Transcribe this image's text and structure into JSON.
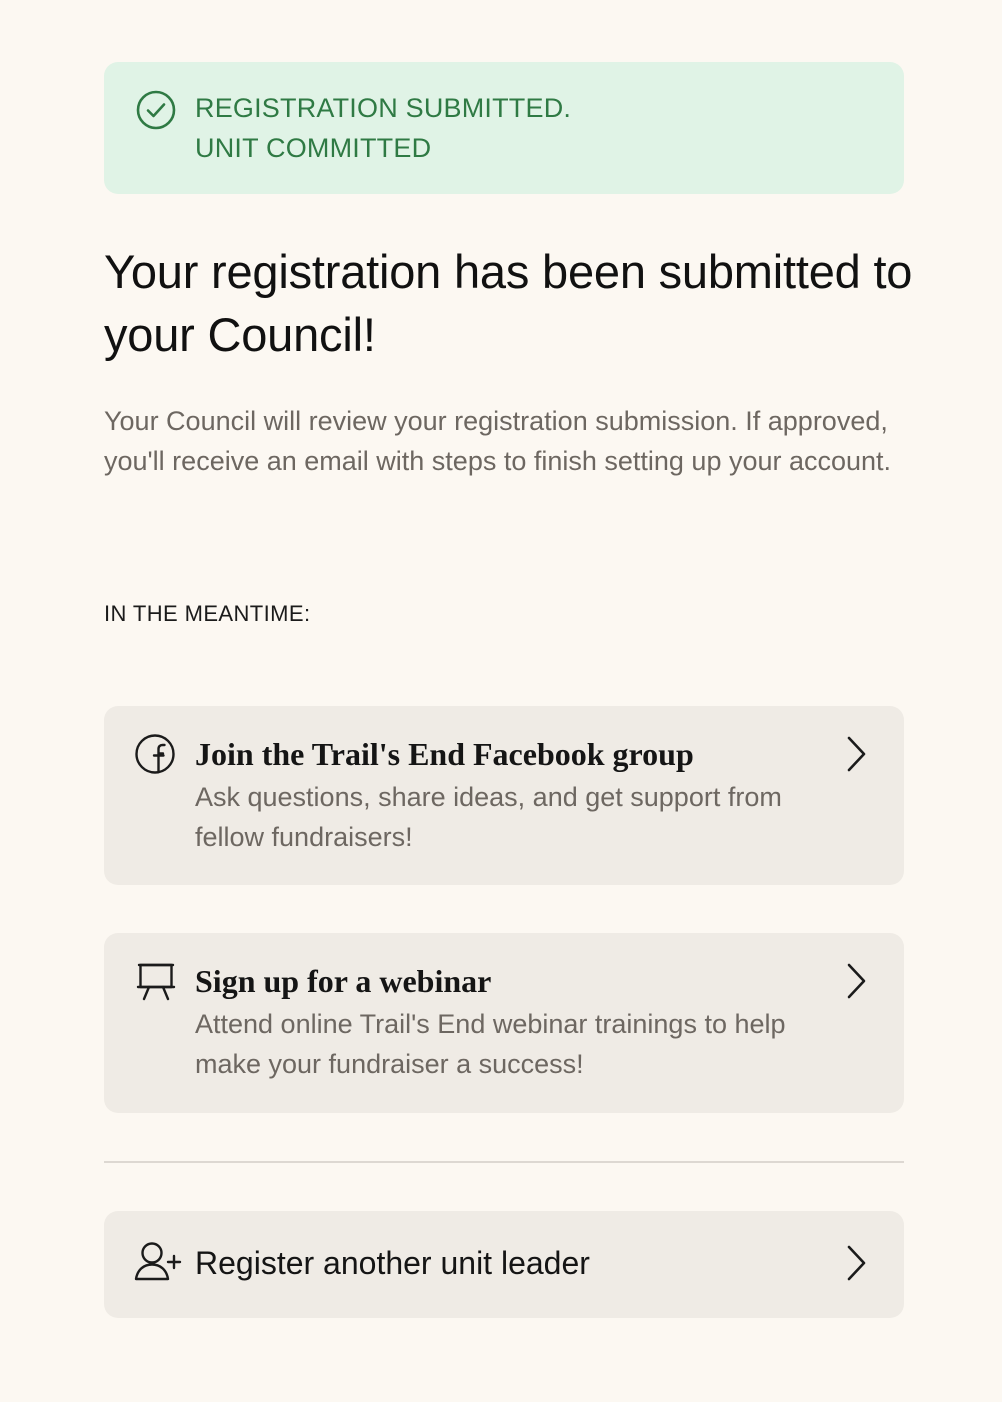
{
  "banner": {
    "status_line_1": "REGISTRATION SUBMITTED.",
    "status_line_2": "UNIT COMMITTED",
    "icon": "check-circle-icon",
    "color": "#2f7a44",
    "background": "#e0f3e6"
  },
  "main": {
    "headline": "Your registration has been submitted to your Council!",
    "intro": "Your Council will review your registration submission. If approved, you'll receive an email with steps to finish setting up your account.",
    "section_label": "IN THE MEANTIME:"
  },
  "cards": {
    "facebook": {
      "icon": "facebook-icon",
      "title": "Join the Trail's End Facebook group",
      "description": "Ask questions, share ideas, and get support from fellow fundraisers!"
    },
    "webinar": {
      "icon": "presentation-board-icon",
      "title": "Sign up for a webinar",
      "description": "Attend online Trail's End webinar trainings to help make your fundraiser a success!"
    },
    "register": {
      "icon": "user-add-icon",
      "label": "Register another unit leader"
    }
  },
  "colors": {
    "page_background": "#fcf8f2",
    "card_background": "#efebe5",
    "text_primary": "#111111",
    "text_muted": "#6d6761"
  }
}
